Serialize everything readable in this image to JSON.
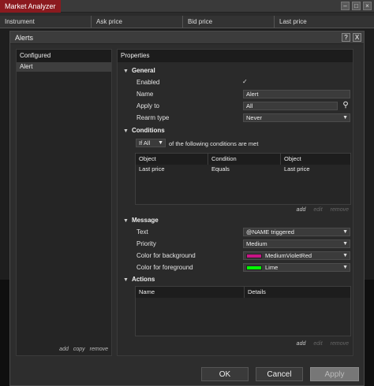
{
  "market_analyzer": {
    "title": "Market Analyzer",
    "columns": [
      "Instrument",
      "Ask price",
      "Bid price",
      "Last price"
    ]
  },
  "dialog": {
    "title": "Alerts",
    "help_label": "?",
    "close_label": "X"
  },
  "configured": {
    "header": "Configured",
    "items": [
      "Alert"
    ],
    "links": {
      "add": "add",
      "copy": "copy",
      "remove": "remove"
    }
  },
  "properties": {
    "header": "Properties",
    "general": {
      "title": "General",
      "enabled_label": "Enabled",
      "enabled": true,
      "name_label": "Name",
      "name_value": "Alert",
      "apply_to_label": "Apply to",
      "apply_to_value": "All",
      "rearm_label": "Rearm type",
      "rearm_value": "Never"
    },
    "conditions": {
      "title": "Conditions",
      "match_mode": "If All",
      "match_text": "of the following conditions are met",
      "columns": [
        "Object",
        "Condition",
        "Object"
      ],
      "rows": [
        [
          "Last price",
          "Equals",
          "Last price"
        ]
      ],
      "links": {
        "add": "add",
        "edit": "edit",
        "remove": "remove"
      }
    },
    "message": {
      "title": "Message",
      "text_label": "Text",
      "text_value": "@NAME triggered",
      "priority_label": "Priority",
      "priority_value": "Medium",
      "bg_label": "Color for background",
      "bg_value": "MediumVioletRed",
      "bg_color": "#c71585",
      "fg_label": "Color for foreground",
      "fg_value": "Lime",
      "fg_color": "#00ff00"
    },
    "actions": {
      "title": "Actions",
      "columns": [
        "Name",
        "Details"
      ],
      "links": {
        "add": "add",
        "edit": "edit",
        "remove": "remove"
      }
    }
  },
  "footer": {
    "ok": "OK",
    "cancel": "Cancel",
    "apply": "Apply"
  },
  "icons": {
    "expanded": "triangle-down-icon",
    "search": "search-icon",
    "dropdown": "chevron-down-icon",
    "check": "checkmark-icon"
  }
}
